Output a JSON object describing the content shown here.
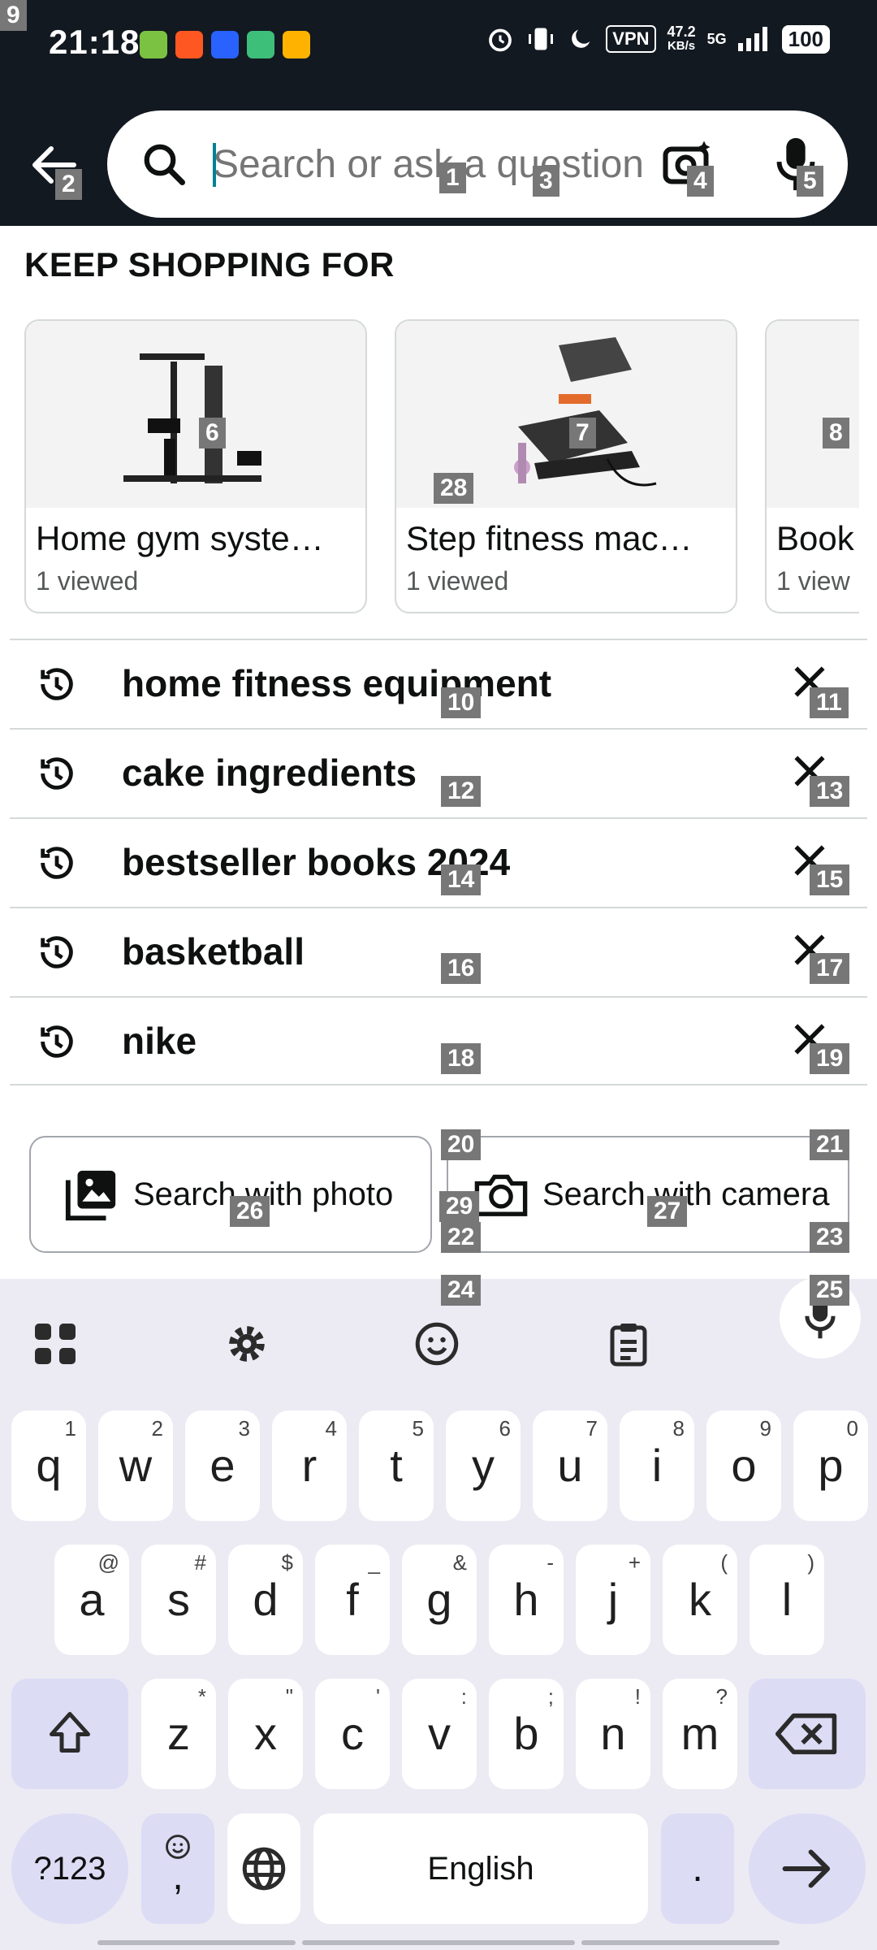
{
  "status_bar": {
    "time": "21:18",
    "vpn": "VPN",
    "speed_value": "47.2",
    "speed_unit": "KB/s",
    "network": "5G",
    "battery": "100"
  },
  "search": {
    "placeholder": "Search or ask a question"
  },
  "keep_shopping": {
    "title": "KEEP SHOPPING FOR",
    "cards": [
      {
        "label": "Home gym syste…",
        "sub": "1 viewed"
      },
      {
        "label": "Step fitness mac…",
        "sub": "1 viewed"
      },
      {
        "label": "Book",
        "sub": "1 view"
      }
    ]
  },
  "history": [
    {
      "label": "home fitness equipment"
    },
    {
      "label": "cake ingredients"
    },
    {
      "label": "bestseller books 2024"
    },
    {
      "label": "basketball"
    },
    {
      "label": "nike"
    }
  ],
  "actions": {
    "photo": "Search with photo",
    "camera": "Search with camera"
  },
  "keyboard": {
    "row1": [
      "q",
      "w",
      "e",
      "r",
      "t",
      "y",
      "u",
      "i",
      "o",
      "p"
    ],
    "row1_hints": [
      "1",
      "2",
      "3",
      "4",
      "5",
      "6",
      "7",
      "8",
      "9",
      "0"
    ],
    "row2": [
      "a",
      "s",
      "d",
      "f",
      "g",
      "h",
      "j",
      "k",
      "l"
    ],
    "row2_hints": [
      "@",
      "#",
      "$",
      "_",
      "&",
      "-",
      "+",
      "(",
      ")"
    ],
    "row3": [
      "z",
      "x",
      "c",
      "v",
      "b",
      "n",
      "m"
    ],
    "row3_hints": [
      "*",
      "\"",
      "'",
      ":",
      ";",
      "!",
      "?"
    ],
    "symbols": "?123",
    "comma": ",",
    "space": "English",
    "period": "."
  },
  "markers": [
    "9",
    "2",
    "1",
    "3",
    "4",
    "5",
    "6",
    "7",
    "8",
    "28",
    "10",
    "11",
    "12",
    "13",
    "14",
    "15",
    "16",
    "17",
    "18",
    "19",
    "20",
    "21",
    "26",
    "29",
    "27",
    "22",
    "23",
    "24",
    "25"
  ]
}
